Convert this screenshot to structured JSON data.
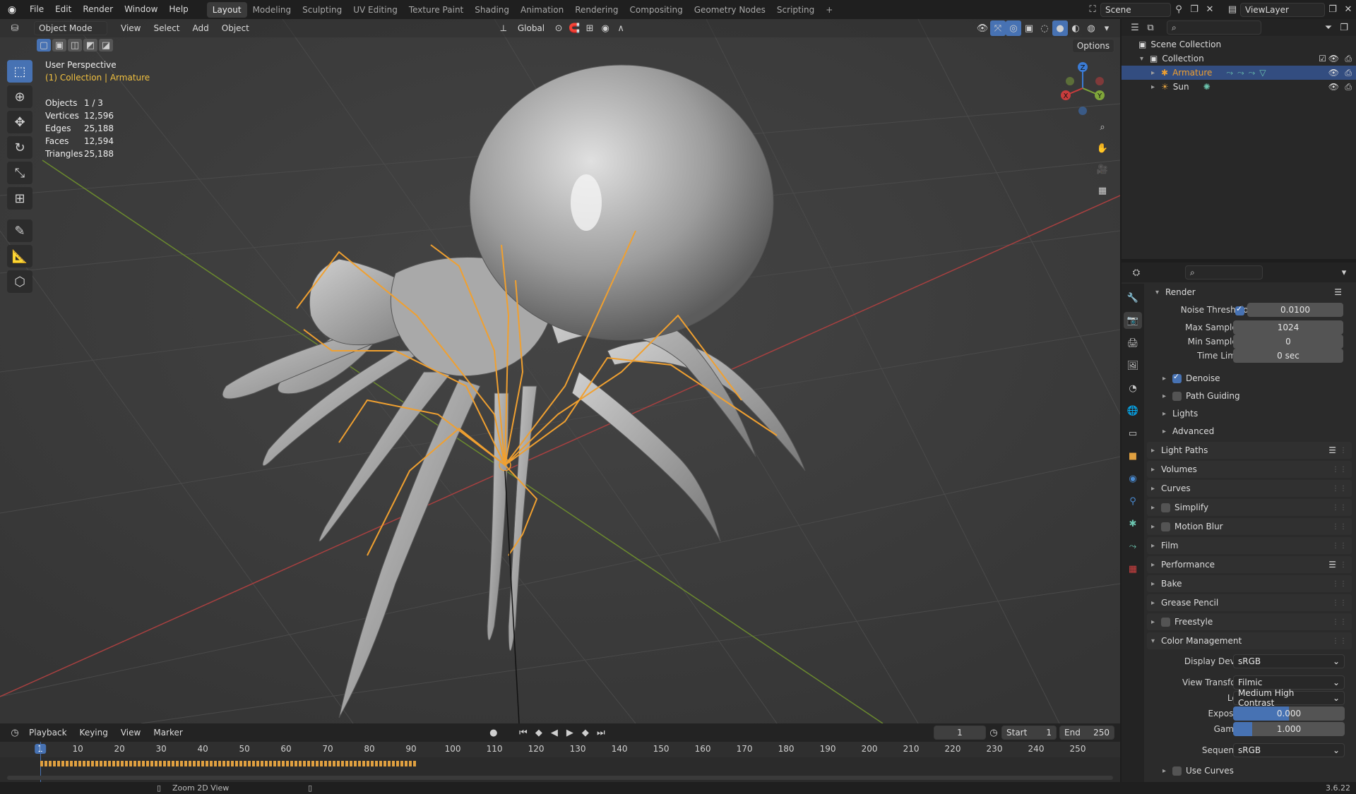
{
  "topbar": {
    "menus": [
      "File",
      "Edit",
      "Render",
      "Window",
      "Help"
    ],
    "workspaces": [
      {
        "label": "Layout",
        "active": true
      },
      {
        "label": "Modeling"
      },
      {
        "label": "Sculpting"
      },
      {
        "label": "UV Editing"
      },
      {
        "label": "Texture Paint"
      },
      {
        "label": "Shading"
      },
      {
        "label": "Animation"
      },
      {
        "label": "Rendering"
      },
      {
        "label": "Compositing"
      },
      {
        "label": "Geometry Nodes"
      },
      {
        "label": "Scripting"
      }
    ],
    "add_tab": "+",
    "scene": "Scene",
    "view_layer": "ViewLayer"
  },
  "viewport": {
    "mode": "Object Mode",
    "menus": [
      "View",
      "Select",
      "Add",
      "Object"
    ],
    "orientation": "Global",
    "options": "Options",
    "view_name": "User Perspective",
    "collection_info": "(1) Collection | Armature",
    "stats": [
      {
        "k": "Objects",
        "v": "1 / 3"
      },
      {
        "k": "Vertices",
        "v": "12,596"
      },
      {
        "k": "Edges",
        "v": "25,188"
      },
      {
        "k": "Faces",
        "v": "12,594"
      },
      {
        "k": "Triangles",
        "v": "25,188"
      }
    ],
    "gizmo": {
      "z": "Z",
      "y": "Y",
      "x": "X"
    }
  },
  "timeline": {
    "menus": [
      "Playback",
      "Keying",
      "View",
      "Marker"
    ],
    "current_frame": "1",
    "start_label": "Start",
    "start": "1",
    "end_label": "End",
    "end": "250",
    "ruler": [
      "1",
      "10",
      "20",
      "30",
      "40",
      "50",
      "60",
      "70",
      "80",
      "90",
      "100",
      "110",
      "120",
      "130",
      "140",
      "150",
      "160",
      "170",
      "180",
      "190",
      "200",
      "210",
      "220",
      "230",
      "240",
      "250"
    ]
  },
  "status": {
    "hint": "Zoom 2D View",
    "version": "3.6.22"
  },
  "outliner": {
    "root": "Scene Collection",
    "collection": "Collection",
    "items": [
      "Armature",
      "Sun"
    ]
  },
  "properties": {
    "render_section": "Render",
    "noise_threshold_label": "Noise Threshold",
    "noise_threshold": "0.0100",
    "max_samples_label": "Max Samples",
    "max_samples": "1024",
    "min_samples_label": "Min Samples",
    "min_samples": "0",
    "time_limit_label": "Time Limit",
    "time_limit": "0 sec",
    "denoise": "Denoise",
    "path_guiding": "Path Guiding",
    "lights": "Lights",
    "advanced": "Advanced",
    "panels": [
      "Light Paths",
      "Volumes",
      "Curves",
      "Simplify",
      "Motion Blur",
      "Film",
      "Performance",
      "Bake",
      "Grease Pencil",
      "Freestyle"
    ],
    "color_management": "Color Management",
    "display_device_label": "Display Device",
    "display_device": "sRGB",
    "view_transform_label": "View Transform",
    "view_transform": "Filmic",
    "look_label": "Look",
    "look": "Medium High Contrast",
    "exposure_label": "Exposure",
    "exposure": "0.000",
    "gamma_label": "Gamma",
    "gamma": "1.000",
    "sequencer_label": "Sequencer",
    "sequencer": "sRGB",
    "use_curves": "Use Curves"
  },
  "colors": {
    "accent": "#4772b3",
    "selection": "#f0a030",
    "x_axis": "#c83c3c",
    "y_axis": "#7fa53a"
  }
}
